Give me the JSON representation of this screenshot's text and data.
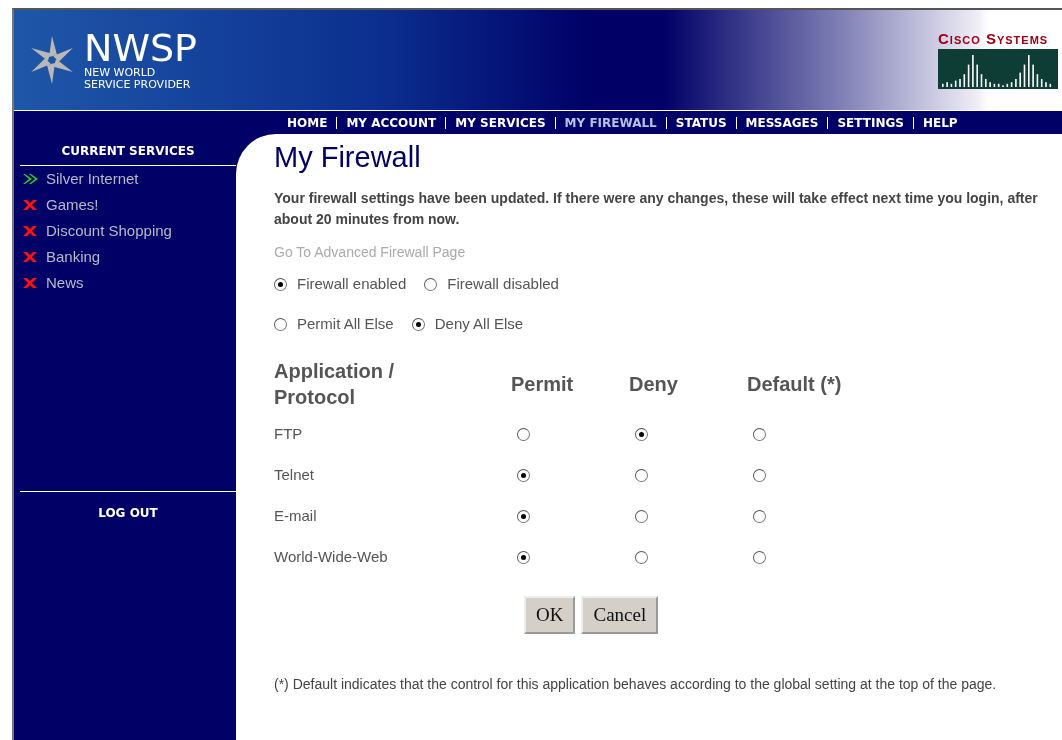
{
  "header": {
    "logo_title": "NWSP",
    "logo_subtitle_lines": [
      "NEW WORLD",
      "SERVICE PROVIDER"
    ],
    "partner_logo": "Cisco Systems"
  },
  "nav": [
    {
      "label": "HOME",
      "selected": false
    },
    {
      "label": "MY ACCOUNT",
      "selected": false
    },
    {
      "label": "MY SERVICES",
      "selected": false
    },
    {
      "label": "MY FIREWALL",
      "selected": true
    },
    {
      "label": "STATUS",
      "selected": false
    },
    {
      "label": "MESSAGES",
      "selected": false
    },
    {
      "label": "SETTINGS",
      "selected": false
    },
    {
      "label": "HELP",
      "selected": false
    }
  ],
  "sidebar": {
    "title": "CURRENT SERVICES",
    "services": [
      {
        "label": "Silver Internet",
        "active": true
      },
      {
        "label": "Games!",
        "active": false
      },
      {
        "label": "Discount Shopping",
        "active": false
      },
      {
        "label": "Banking",
        "active": false
      },
      {
        "label": "News",
        "active": false
      }
    ],
    "logout": "LOG OUT"
  },
  "content": {
    "title": "My Firewall",
    "message": "Your firewall settings have been updated. If there were any changes, these will take effect next time you login, after about 20 minutes from now.",
    "advanced_link": "Go To Advanced Firewall Page",
    "firewall_mode": [
      {
        "label": "Firewall enabled",
        "selected": true
      },
      {
        "label": "Firewall disabled",
        "selected": false
      }
    ],
    "default_policy": [
      {
        "label": "Permit All Else",
        "selected": false
      },
      {
        "label": "Deny All Else",
        "selected": true
      }
    ],
    "table": {
      "columns": [
        "Application / Protocol",
        "Permit",
        "Deny",
        "Default (*)"
      ],
      "rows": [
        {
          "name": "FTP",
          "options": [
            {
              "selected": false
            },
            {
              "selected": true
            },
            {
              "selected": false
            }
          ]
        },
        {
          "name": "Telnet",
          "options": [
            {
              "selected": true
            },
            {
              "selected": false
            },
            {
              "selected": false
            }
          ]
        },
        {
          "name": "E-mail",
          "options": [
            {
              "selected": true
            },
            {
              "selected": false
            },
            {
              "selected": false
            }
          ]
        },
        {
          "name": "World-Wide-Web",
          "options": [
            {
              "selected": true
            },
            {
              "selected": false
            },
            {
              "selected": false
            }
          ]
        }
      ]
    },
    "buttons": [
      "OK",
      "Cancel"
    ],
    "footnote": "(*) Default indicates that the control for this application behaves according to the global setting at the top of the page."
  }
}
